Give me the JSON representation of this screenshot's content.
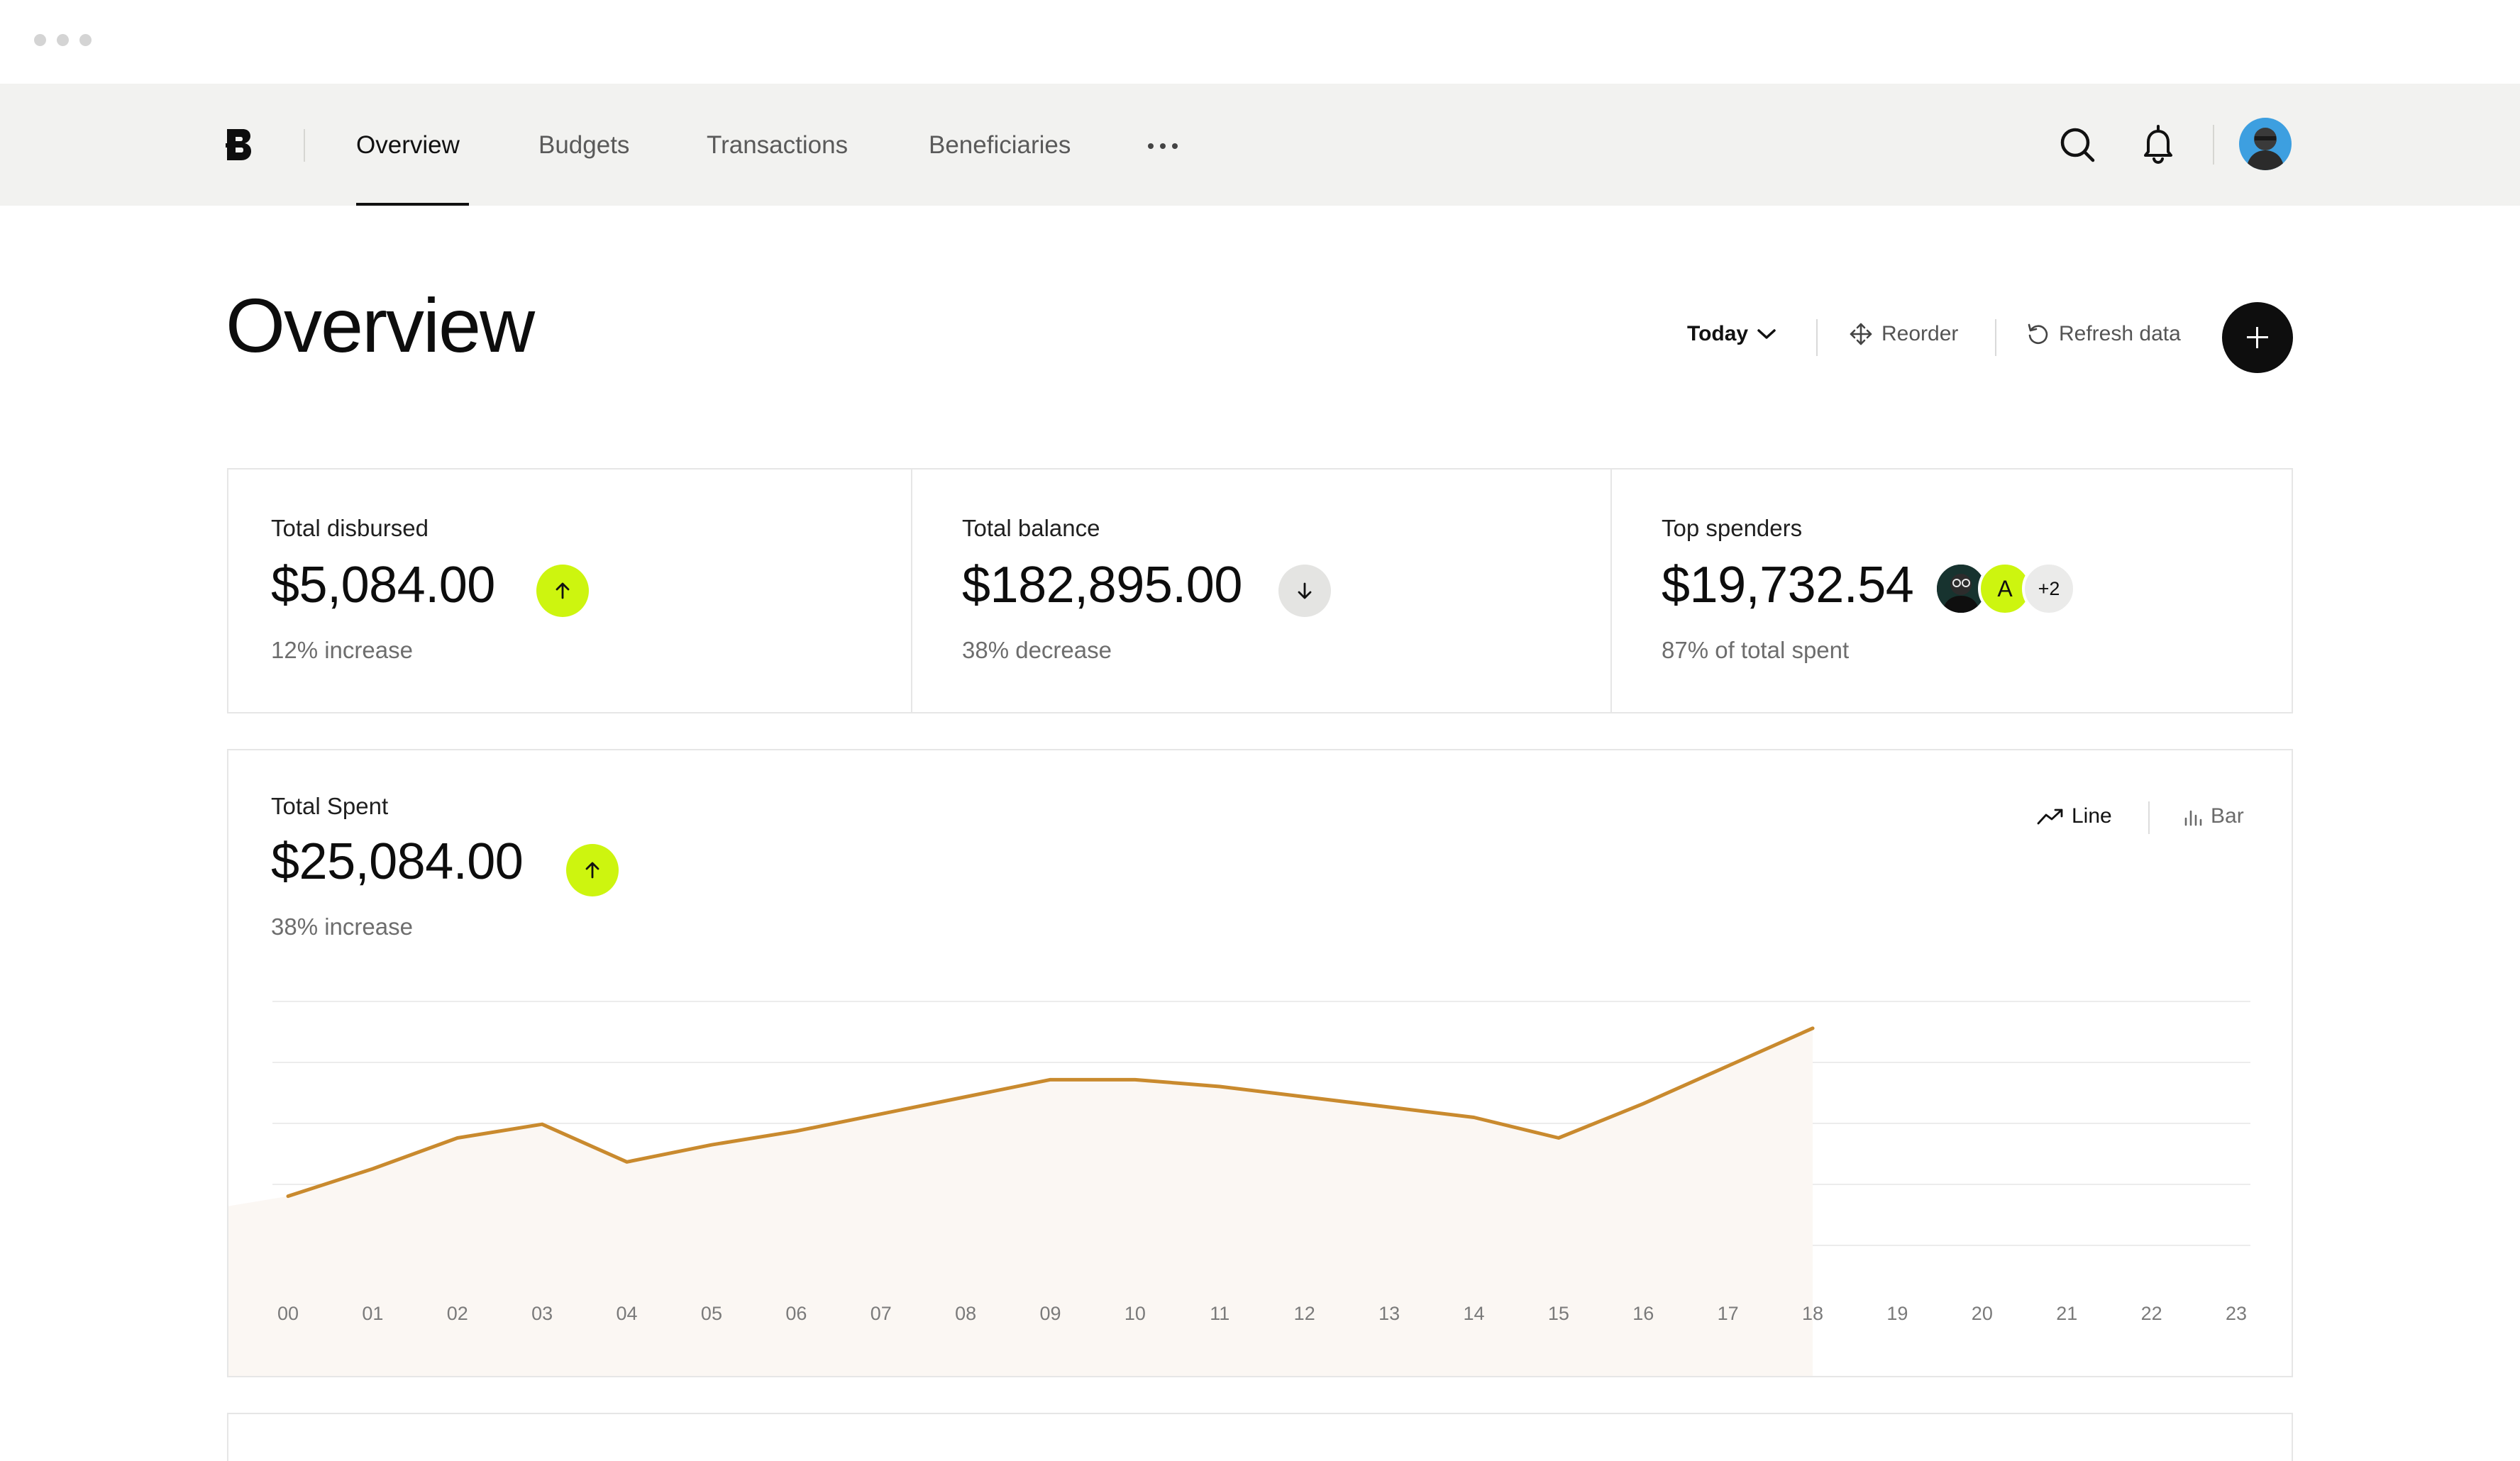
{
  "nav": {
    "items": [
      {
        "label": "Overview",
        "active": true
      },
      {
        "label": "Budgets",
        "active": false
      },
      {
        "label": "Transactions",
        "active": false
      },
      {
        "label": "Beneficiaries",
        "active": false
      }
    ],
    "more_icon": "more-horizontal-icon",
    "search_icon": "search-icon",
    "notification_icon": "bell-icon",
    "avatar": "user-avatar"
  },
  "header": {
    "title": "Overview",
    "period": "Today",
    "reorder": "Reorder",
    "refresh": "Refresh data",
    "add_icon": "plus-icon"
  },
  "stats": {
    "disbursed": {
      "label": "Total disbursed",
      "value": "$5,084.00",
      "trend": "up",
      "sub": "12% increase"
    },
    "balance": {
      "label": "Total balance",
      "value": "$182,895.00",
      "trend": "down",
      "sub": "38% decrease"
    },
    "spenders": {
      "label": "Top spenders",
      "value": "$19,732.54",
      "avatar_letter": "A",
      "more_count": "+2",
      "sub": "87% of total spent"
    }
  },
  "total_spent": {
    "label": "Total Spent",
    "value": "$25,084.00",
    "trend": "up",
    "sub": "38% increase",
    "toggle_line": "Line",
    "toggle_bar": "Bar",
    "active_view": "line"
  },
  "colors": {
    "accent": "#cdf50f",
    "line": "#c98a2e",
    "area": "#fbf7f3",
    "nav_bg": "#f2f2f0",
    "text": "#0d0d0d"
  },
  "chart_data": {
    "type": "line",
    "x": [
      "00",
      "01",
      "02",
      "03",
      "04",
      "05",
      "06",
      "07",
      "08",
      "09",
      "10",
      "11",
      "12",
      "13",
      "14",
      "15",
      "16",
      "17",
      "18",
      "19",
      "20",
      "21",
      "22",
      "23"
    ],
    "values": [
      2.6,
      3.0,
      3.45,
      3.65,
      3.1,
      3.35,
      3.55,
      3.8,
      4.05,
      4.3,
      4.3,
      4.2,
      4.05,
      3.9,
      3.75,
      3.45,
      3.95,
      4.5,
      5.05,
      null,
      null,
      null,
      null,
      null
    ],
    "ylim": [
      0,
      6
    ],
    "grid": true,
    "series": [
      {
        "values": [
          2.6,
          3.0,
          3.45,
          3.65,
          3.1,
          3.35,
          3.55,
          3.8,
          4.05,
          4.3,
          4.3,
          4.2,
          4.05,
          3.9,
          3.75,
          3.45,
          3.95,
          4.5,
          5.05
        ]
      }
    ]
  }
}
